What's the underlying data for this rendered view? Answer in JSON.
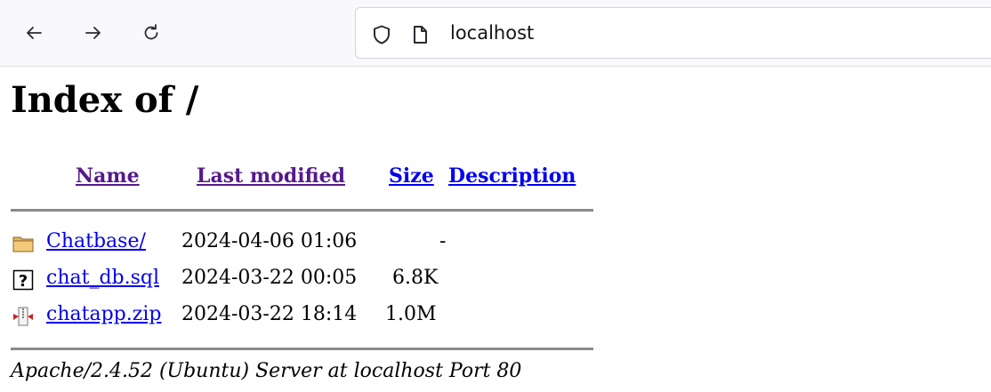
{
  "browser": {
    "url": "localhost",
    "back_icon": "arrow-left-icon",
    "forward_icon": "arrow-right-icon",
    "reload_icon": "reload-icon",
    "shield_icon": "shield-icon",
    "page_icon": "page-icon"
  },
  "page": {
    "title": "Index of /",
    "columns": {
      "name": "Name",
      "modified": "Last modified",
      "size": "Size",
      "description": "Description"
    },
    "entries": [
      {
        "name": "Chatbase/",
        "modified": "2024-04-06 01:06",
        "size": "-",
        "icon": "folder-icon"
      },
      {
        "name": "chat_db.sql",
        "modified": "2024-03-22 00:05",
        "size": "6.8K",
        "icon": "unknown-file-icon"
      },
      {
        "name": "chatapp.zip",
        "modified": "2024-03-22 18:14",
        "size": "1.0M",
        "icon": "compressed-file-icon"
      }
    ],
    "address": "Apache/2.4.52 (Ubuntu) Server at localhost Port 80"
  },
  "colors": {
    "link": "#0000ee",
    "visited_link": "#551a8b",
    "rule": "#8a8a8a"
  }
}
